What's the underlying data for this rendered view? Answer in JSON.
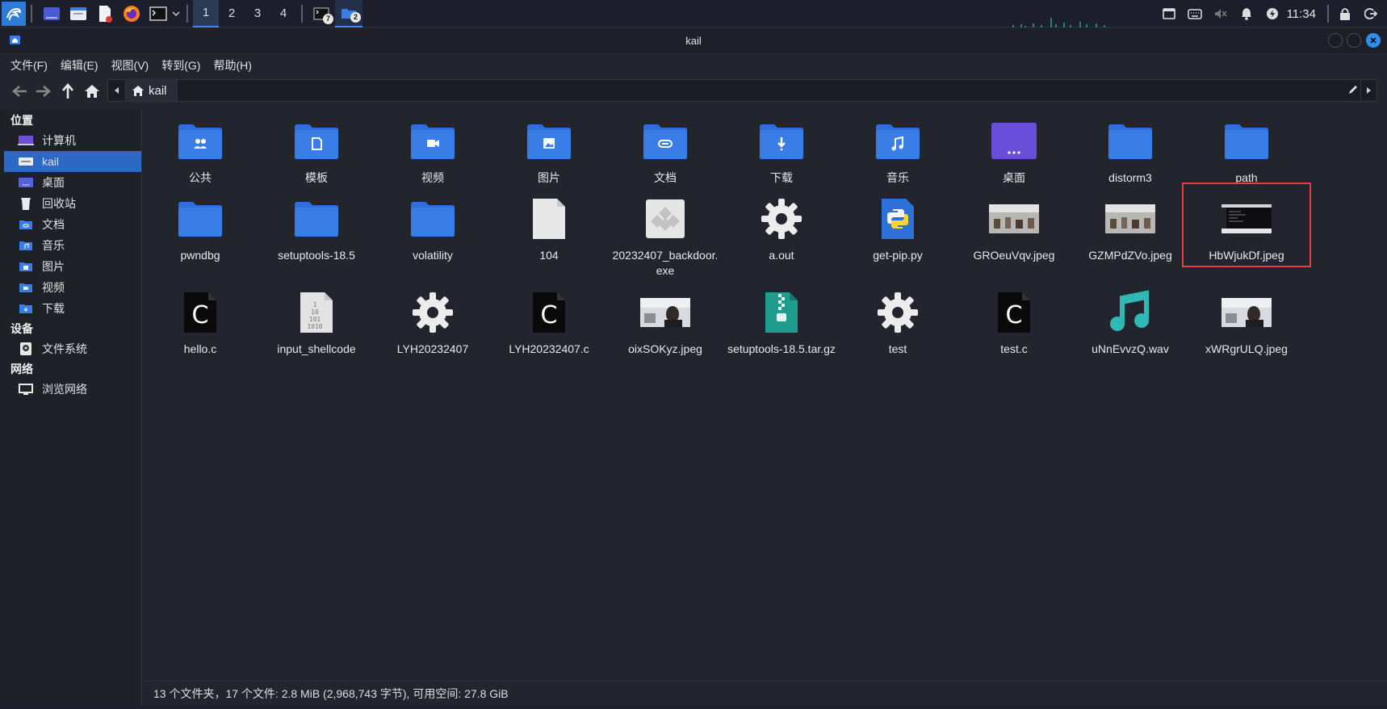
{
  "panel": {
    "workspaces": [
      "1",
      "2",
      "3",
      "4"
    ],
    "active_workspace": "1",
    "terminal_badge": "7",
    "files_badge": "2",
    "clock": "11:34"
  },
  "window": {
    "title": "kail"
  },
  "menu": [
    "文件(F)",
    "编辑(E)",
    "视图(V)",
    "转到(G)",
    "帮助(H)"
  ],
  "location": {
    "crumb": "kail"
  },
  "sidebar": {
    "places_header": "位置",
    "places": [
      {
        "label": "计算机",
        "icon": "computer-icon"
      },
      {
        "label": "kail",
        "icon": "home-drive-icon"
      },
      {
        "label": "桌面",
        "icon": "desktop-icon"
      },
      {
        "label": "回收站",
        "icon": "trash-icon"
      },
      {
        "label": "文档",
        "icon": "documents-icon"
      },
      {
        "label": "音乐",
        "icon": "music-icon"
      },
      {
        "label": "图片",
        "icon": "pictures-icon"
      },
      {
        "label": "视频",
        "icon": "videos-icon"
      },
      {
        "label": "下载",
        "icon": "downloads-icon"
      }
    ],
    "devices_header": "设备",
    "devices": [
      {
        "label": "文件系统",
        "icon": "filesystem-icon"
      }
    ],
    "network_header": "网络",
    "network": [
      {
        "label": "浏览网络",
        "icon": "network-icon"
      }
    ]
  },
  "files": [
    {
      "name": "公共",
      "type": "folder-public"
    },
    {
      "name": "模板",
      "type": "folder-templates"
    },
    {
      "name": "视频",
      "type": "folder-videos"
    },
    {
      "name": "图片",
      "type": "folder-pictures"
    },
    {
      "name": "文档",
      "type": "folder-documents"
    },
    {
      "name": "下载",
      "type": "folder-downloads"
    },
    {
      "name": "音乐",
      "type": "folder-music"
    },
    {
      "name": "桌面",
      "type": "folder-desktop"
    },
    {
      "name": "distorm3",
      "type": "folder"
    },
    {
      "name": "path",
      "type": "folder"
    },
    {
      "name": "pwndbg",
      "type": "folder"
    },
    {
      "name": "setuptools-18.5",
      "type": "folder"
    },
    {
      "name": "volatility",
      "type": "folder"
    },
    {
      "name": "104",
      "type": "blank-file"
    },
    {
      "name": "20232407_backdoor.exe",
      "type": "exe"
    },
    {
      "name": "a.out",
      "type": "gear"
    },
    {
      "name": "get-pip.py",
      "type": "python"
    },
    {
      "name": "GROeuVqv.jpeg",
      "type": "photo"
    },
    {
      "name": "GZMPdZVo.jpeg",
      "type": "photo"
    },
    {
      "name": "HbWjukDf.jpeg",
      "type": "screenshot",
      "highlighted": true
    },
    {
      "name": "hello.c",
      "type": "c-source"
    },
    {
      "name": "input_shellcode",
      "type": "binary"
    },
    {
      "name": "LYH20232407",
      "type": "gear"
    },
    {
      "name": "LYH20232407.c",
      "type": "c-source"
    },
    {
      "name": "oixSOKyz.jpeg",
      "type": "photo-person"
    },
    {
      "name": "setuptools-18.5.tar.gz",
      "type": "archive"
    },
    {
      "name": "test",
      "type": "gear"
    },
    {
      "name": "test.c",
      "type": "c-source"
    },
    {
      "name": "uNnEvvzQ.wav",
      "type": "audio"
    },
    {
      "name": "xWRgrULQ.jpeg",
      "type": "photo-person"
    }
  ],
  "status": "13 个文件夹，17 个文件: 2.8 MiB (2,968,743 字节), 可用空间: 27.8 GiB",
  "colors": {
    "folder_blue": "#3a7de6",
    "selection": "#2d68c4",
    "highlight_box": "#e33f3f"
  }
}
